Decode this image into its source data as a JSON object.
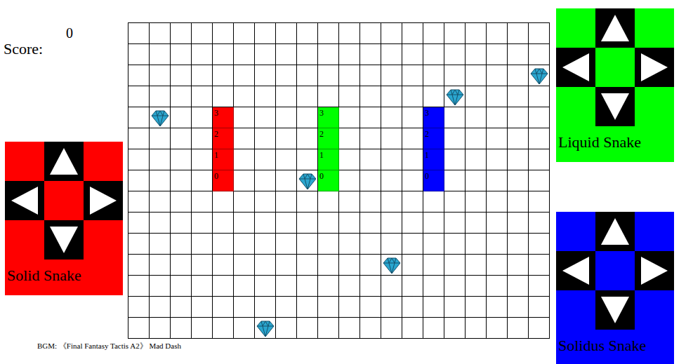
{
  "score": {
    "label": "Score:",
    "value": "0"
  },
  "board": {
    "columns": 20,
    "rows": 15
  },
  "snakes": [
    {
      "name": "Solid Snake",
      "color": "#ff0000",
      "segments": [
        {
          "label": "3",
          "row": 4,
          "col": 4
        },
        {
          "label": "2",
          "row": 5,
          "col": 4
        },
        {
          "label": "1",
          "row": 6,
          "col": 4
        },
        {
          "label": "0",
          "row": 7,
          "col": 4
        }
      ]
    },
    {
      "name": "Liquid Snake",
      "color": "#00ff00",
      "segments": [
        {
          "label": "3",
          "row": 4,
          "col": 9
        },
        {
          "label": "2",
          "row": 5,
          "col": 9
        },
        {
          "label": "1",
          "row": 6,
          "col": 9
        },
        {
          "label": "0",
          "row": 7,
          "col": 9
        }
      ]
    },
    {
      "name": "Solidus Snake",
      "color": "#0000ff",
      "segments": [
        {
          "label": "3",
          "row": 4,
          "col": 14
        },
        {
          "label": "2",
          "row": 5,
          "col": 14
        },
        {
          "label": "1",
          "row": 6,
          "col": 14
        },
        {
          "label": "0",
          "row": 7,
          "col": 14
        }
      ]
    }
  ],
  "gems": [
    {
      "row": 4,
      "col": 1
    },
    {
      "row": 7,
      "col": 8
    },
    {
      "row": 3,
      "col": 15
    },
    {
      "row": 2,
      "col": 19
    },
    {
      "row": 11,
      "col": 12
    },
    {
      "row": 14,
      "col": 6
    }
  ],
  "footer": "BGM: 《Final Fantasy Tactis A2》 Mad Dash"
}
